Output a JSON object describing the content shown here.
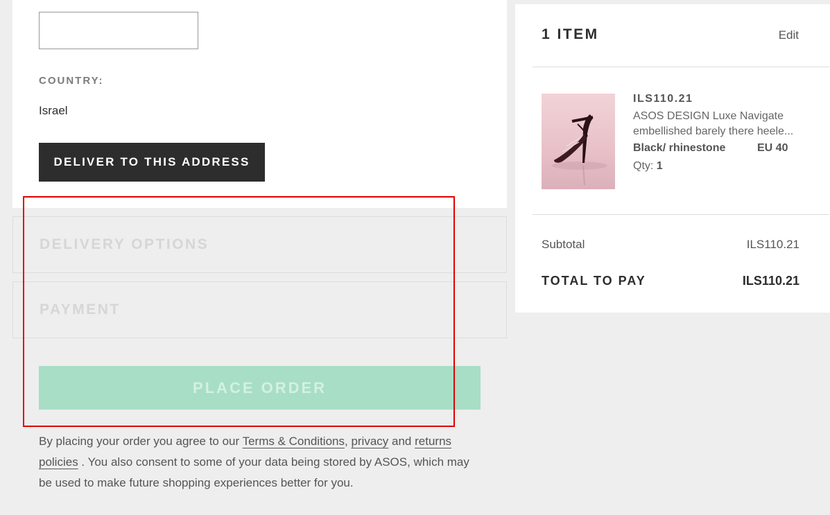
{
  "address": {
    "input_value": "",
    "country_label": "COUNTRY:",
    "country_value": "Israel",
    "deliver_button": "DELIVER TO THIS ADDRESS"
  },
  "steps": {
    "delivery_title": "DELIVERY OPTIONS",
    "payment_title": "PAYMENT"
  },
  "place_order_label": "PLACE ORDER",
  "legal": {
    "prefix": "By placing your order you agree to our ",
    "terms_link": "Terms & Conditions",
    "comma": ", ",
    "privacy_link": "privacy",
    "and": " and ",
    "returns_link": "returns policies",
    "suffix": " . You also consent to some of your data being stored by ASOS, which may be used to make future shopping experiences better for you."
  },
  "summary": {
    "title": "1 ITEM",
    "edit_label": "Edit",
    "item": {
      "price": "ILS110.21",
      "name_line1": "ASOS DESIGN Luxe Navigate",
      "name_line2": "embellished barely there heele...",
      "variant": "Black/ rhinestone",
      "size": "EU 40",
      "qty_label": "Qty:",
      "qty_value": "1"
    },
    "subtotal_label": "Subtotal",
    "subtotal_value": "ILS110.21",
    "total_label": "TOTAL TO PAY",
    "total_value": "ILS110.21"
  },
  "colors": {
    "background": "#eeeeee",
    "button_dark": "#2d2d2d",
    "place_order_disabled": "#a8dec6",
    "highlight": "#e00000"
  },
  "icons": {
    "product_image": "heeled-sandal-photo"
  }
}
